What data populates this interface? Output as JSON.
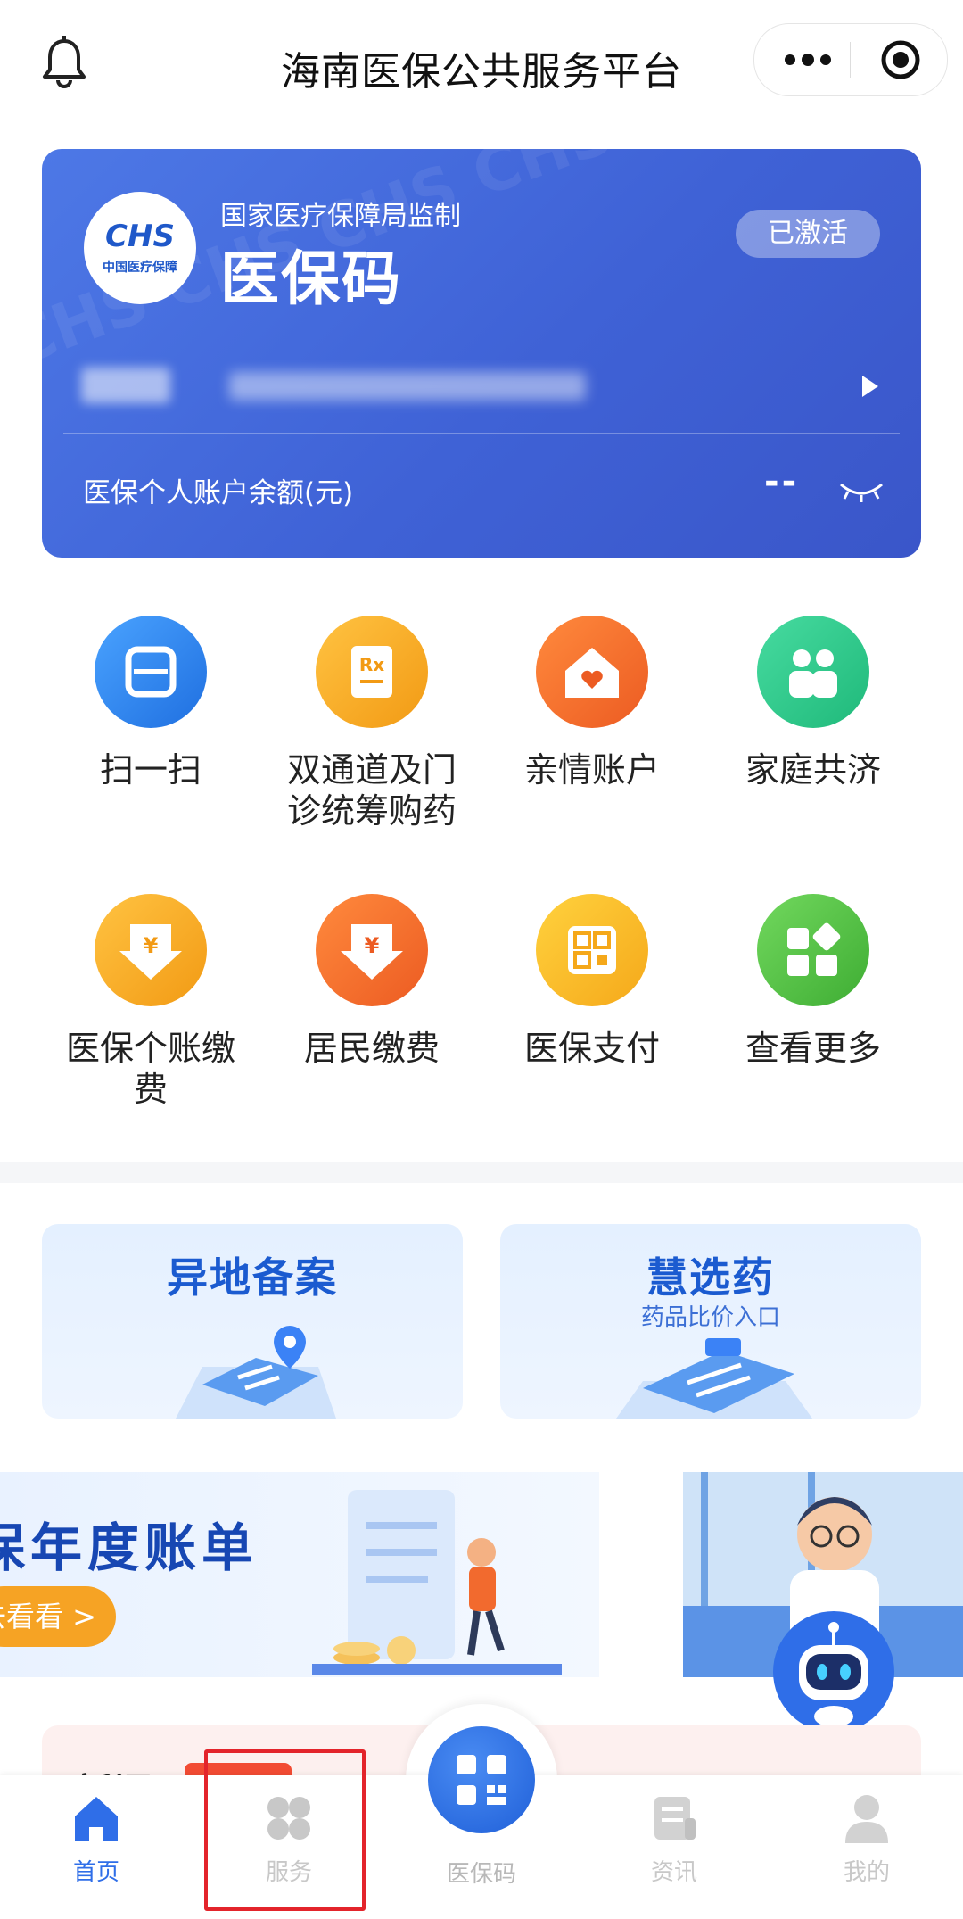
{
  "header": {
    "title": "海南医保公共服务平台"
  },
  "card": {
    "supervise": "国家医疗保障局监制",
    "title": "医保码",
    "status": "已激活",
    "logo_text": "CHS",
    "logo_cn": "中国医疗保障",
    "balance_label": "医保个人账户余额(元)",
    "balance_value": "--"
  },
  "grid": [
    {
      "label": "扫一扫",
      "icon": "scan-icon",
      "color": "#2f86f0"
    },
    {
      "label": "双通道及门诊统筹购药",
      "icon": "prescription-icon",
      "color": "#f5a623"
    },
    {
      "label": "亲情账户",
      "icon": "family-home-icon",
      "color": "#f26a2e"
    },
    {
      "label": "家庭共济",
      "icon": "family-icon",
      "color": "#2fc98a"
    },
    {
      "label": "医保个账缴费",
      "icon": "yuan-download-icon",
      "color": "#f6a623"
    },
    {
      "label": "居民缴费",
      "icon": "yuan-download-icon",
      "color": "#f2682e"
    },
    {
      "label": "医保支付",
      "icon": "qr-payment-icon",
      "color": "#f8b51e"
    },
    {
      "label": "查看更多",
      "icon": "more-apps-icon",
      "color": "#52c04a"
    }
  ],
  "promos": [
    {
      "title": "异地备案",
      "subtitle": ""
    },
    {
      "title": "慧选药",
      "subtitle": "药品比价入口"
    }
  ],
  "banner": {
    "text": "保年度账单",
    "button": "去看看 >"
  },
  "news": {
    "text": "新闻"
  },
  "tabs": [
    {
      "label": "首页"
    },
    {
      "label": "服务"
    },
    {
      "label": "医保码"
    },
    {
      "label": "资讯"
    },
    {
      "label": "我的"
    }
  ],
  "colors": {
    "accent": "#2f6ee8",
    "card": "#4566d8",
    "highlight": "#e3242b"
  }
}
